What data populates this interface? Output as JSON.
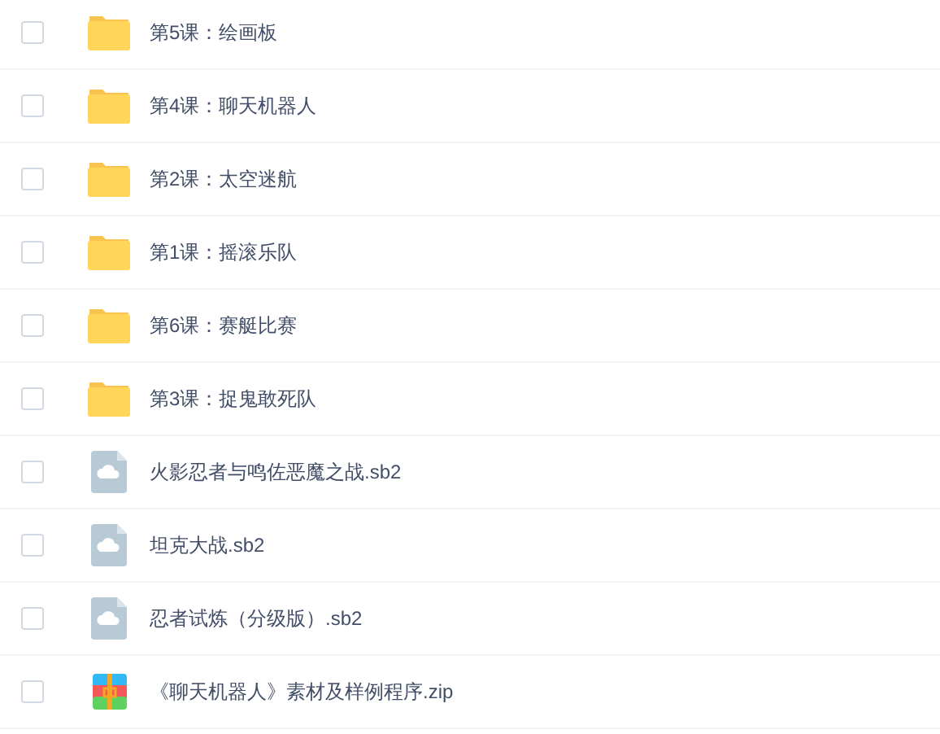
{
  "files": [
    {
      "kind": "folder",
      "name": "第5课：绘画板",
      "checked": false
    },
    {
      "kind": "folder",
      "name": "第4课：聊天机器人",
      "checked": false
    },
    {
      "kind": "folder",
      "name": "第2课：太空迷航",
      "checked": false
    },
    {
      "kind": "folder",
      "name": "第1课：摇滚乐队",
      "checked": false
    },
    {
      "kind": "folder",
      "name": "第6课：赛艇比赛",
      "checked": false
    },
    {
      "kind": "folder",
      "name": "第3课：捉鬼敢死队",
      "checked": false
    },
    {
      "kind": "file",
      "name": "火影忍者与鸣佐恶魔之战.sb2",
      "checked": false
    },
    {
      "kind": "file",
      "name": "坦克大战.sb2",
      "checked": false
    },
    {
      "kind": "file",
      "name": "忍者试炼（分级版）.sb2",
      "checked": false
    },
    {
      "kind": "archive",
      "name": "《聊天机器人》素材及样例程序.zip",
      "checked": false
    }
  ]
}
